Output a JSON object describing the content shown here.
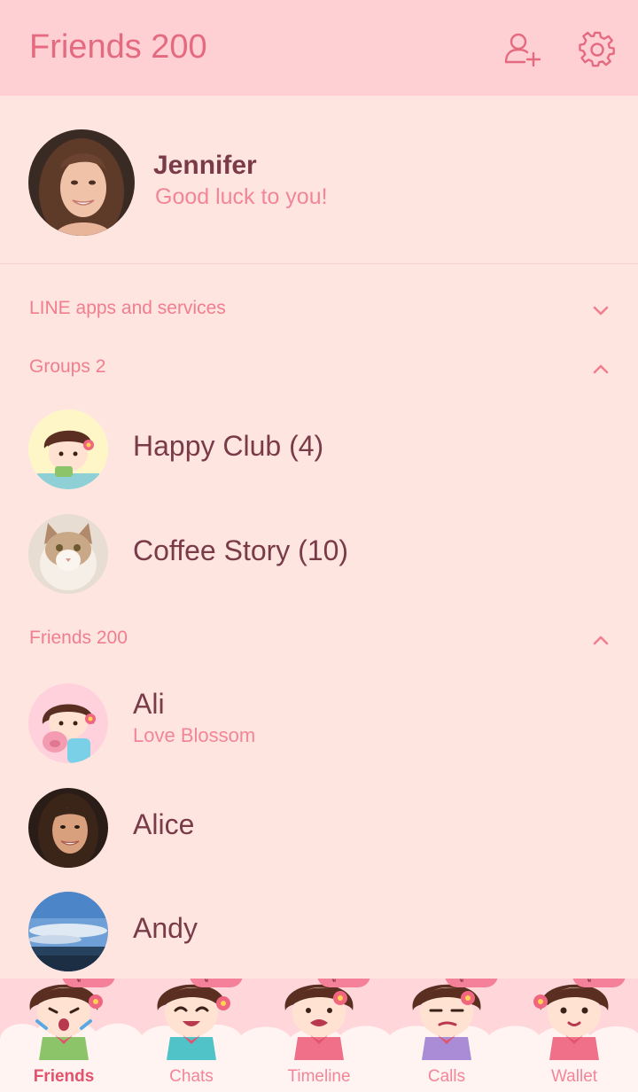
{
  "header": {
    "title": "Friends 200",
    "add_friend_icon": "add-person-icon",
    "settings_icon": "gear-icon"
  },
  "profile": {
    "name": "Jennifer",
    "status": "Good luck to you!"
  },
  "sections": {
    "line_apps": "LINE apps and services",
    "groups": "Groups 2",
    "friends": "Friends 200"
  },
  "groups": [
    {
      "name": "Happy Club (4)"
    },
    {
      "name": "Coffee Story (10)"
    }
  ],
  "friends": [
    {
      "name": "Ali",
      "status": "Love Blossom"
    },
    {
      "name": "Alice",
      "status": ""
    },
    {
      "name": "Andy",
      "status": ""
    }
  ],
  "tabs": [
    {
      "label": "Friends",
      "tag": "ครูกานต์"
    },
    {
      "label": "Chats",
      "tag": "ครูกานต์"
    },
    {
      "label": "Timeline",
      "tag": "ครูกานต์"
    },
    {
      "label": "Calls",
      "tag": "ครูกานต์"
    },
    {
      "label": "Wallet",
      "tag": "ครูกานต์"
    }
  ],
  "colors": {
    "accent": "#e46a80",
    "background": "#ffe5e0",
    "header": "#ffd0d3",
    "text": "#7a3b49"
  }
}
